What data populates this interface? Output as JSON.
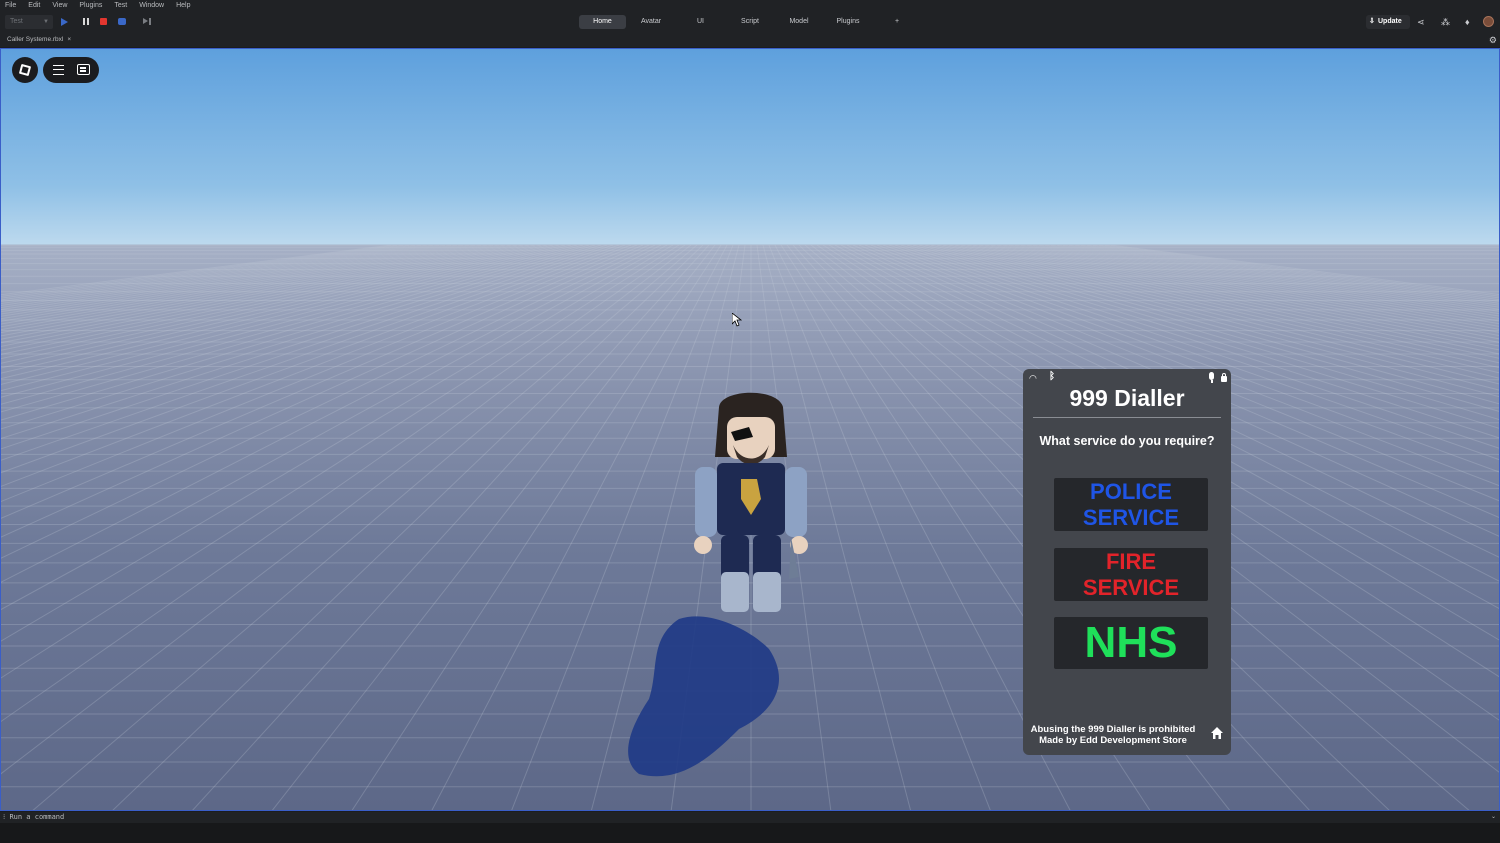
{
  "menu": [
    "File",
    "Edit",
    "View",
    "Plugins",
    "Test",
    "Window",
    "Help"
  ],
  "toolbar": {
    "mode": "Test",
    "tabs": [
      {
        "label": "Home",
        "active": true
      },
      {
        "label": "Avatar",
        "active": false
      },
      {
        "label": "UI",
        "active": false
      },
      {
        "label": "Script",
        "active": false
      },
      {
        "label": "Model",
        "active": false
      },
      {
        "label": "Plugins",
        "active": false
      },
      {
        "label": "+",
        "active": false
      }
    ],
    "update_label": "Update"
  },
  "file_tab": {
    "name": "Caller Systeme.rbxl",
    "close": "×"
  },
  "dialler": {
    "title": "999 Dialler",
    "question": "What service do you require?",
    "police": "POLICE SERVICE",
    "fire": "FIRE SERVICE",
    "nhs": "NHS",
    "notice": "Abusing the 999 Dialler is prohibited",
    "credit": "Made by Edd Development Store",
    "colors": {
      "police": "#1f55e6",
      "fire": "#e2232a",
      "nhs": "#1fe05a"
    }
  },
  "command_bar": {
    "placeholder": "Run a command"
  },
  "icons": [
    "roblox-logo-icon",
    "hamburger-icon",
    "chat-icon",
    "wifi-icon",
    "bluetooth-icon",
    "microphone-icon",
    "lock-icon",
    "home-icon",
    "play-icon",
    "pause-icon",
    "stop-icon",
    "share-icon",
    "bell-icon",
    "gear-icon"
  ]
}
